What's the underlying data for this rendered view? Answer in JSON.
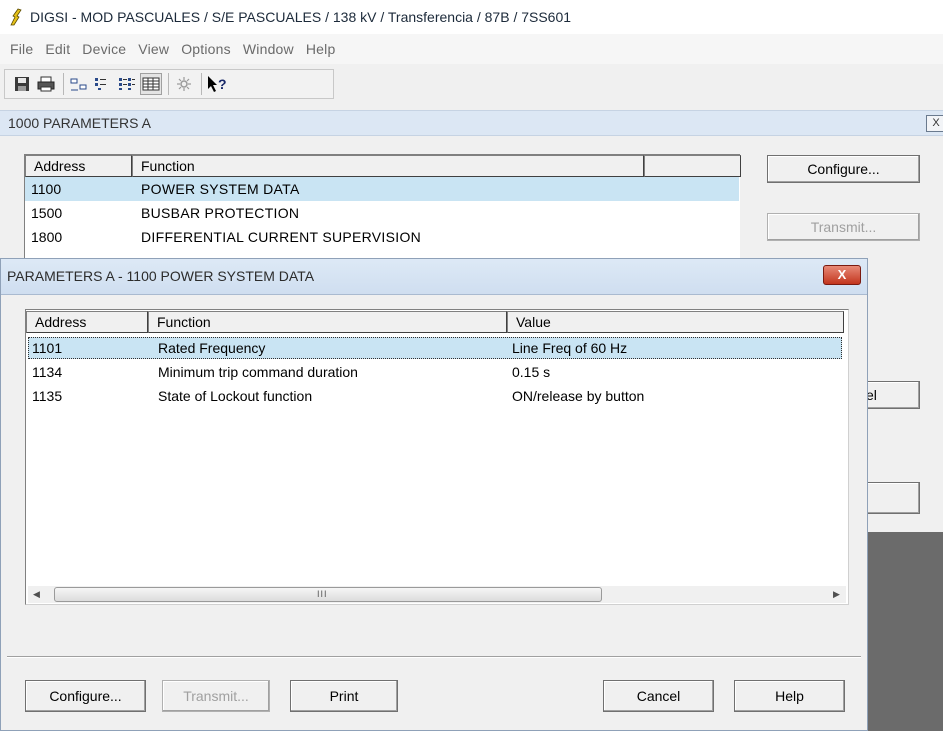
{
  "window": {
    "title": "DIGSI - MOD PASCUALES / S/E PASCUALES / 138 kV / Transferencia / 87B / 7SS601"
  },
  "menu": [
    "File",
    "Edit",
    "Device",
    "View",
    "Options",
    "Window",
    "Help"
  ],
  "toolbar": {
    "icons": [
      "save-icon",
      "print-icon",
      "large-icons-icon",
      "small-icons-icon",
      "list-icon",
      "details-icon",
      "filter-icon",
      "whats-this-help-icon"
    ]
  },
  "mdi": {
    "title": "1000  PARAMETERS A",
    "close_label": "X",
    "columns": [
      "Address",
      "Function",
      ""
    ],
    "rows": [
      {
        "address": "1100",
        "function": "POWER SYSTEM DATA"
      },
      {
        "address": "1500",
        "function": "BUSBAR PROTECTION"
      },
      {
        "address": "1800",
        "function": "DIFFERENTIAL CURRENT SUPERVISION"
      }
    ],
    "buttons": {
      "configure": "Configure...",
      "transmit": "Transmit...",
      "cancel_partial": "el"
    }
  },
  "dialog": {
    "title": "PARAMETERS A - 1100  POWER SYSTEM DATA",
    "close_label": "X",
    "columns": [
      "Address",
      "Function",
      "Value"
    ],
    "rows": [
      {
        "address": "1101",
        "function": "Rated Frequency",
        "value": "Line Freq of 60 Hz"
      },
      {
        "address": "1134",
        "function": "Minimum trip command duration",
        "value": "0.15 s"
      },
      {
        "address": "1135",
        "function": "State of Lockout function",
        "value": "ON/release by button"
      }
    ],
    "scroll": {
      "left": "◀",
      "right": "▶",
      "grip": "III"
    },
    "buttons": {
      "configure": "Configure...",
      "transmit": "Transmit...",
      "print": "Print",
      "cancel": "Cancel",
      "help": "Help"
    }
  },
  "colors": {
    "selection": "#c9e4f3",
    "dialog_title": "#dce7f4",
    "close_red": "#c2351e"
  }
}
